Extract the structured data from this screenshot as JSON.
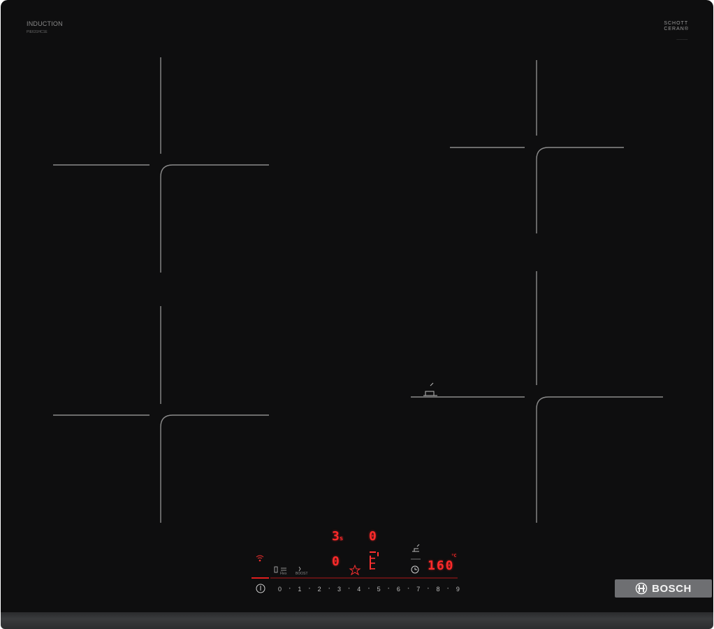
{
  "panel": {
    "brand_label": "INDUCTION",
    "model_label": "PIE631HC1E",
    "glass_brand_top": "SCHOTT",
    "glass_brand_bottom": "CERAN®",
    "manufacturer": "BOSCH"
  },
  "display": {
    "timer_top": "3",
    "timer_top_unit": "s",
    "zone_top_value": "0",
    "zone_bottom_value": "0",
    "temperature": "160",
    "temperature_unit": "°C"
  },
  "control_labels": {
    "flex": "Flex",
    "boost": "BOOST",
    "power_icon": "power-icon",
    "wifi_icon": "wifi-icon",
    "favorite_icon": "star-icon",
    "timer_icon": "clock-icon",
    "pan_sensor_icon": "frying-sensor-icon"
  },
  "power_scale": [
    "0",
    "1",
    "2",
    "3",
    "4",
    "5",
    "6",
    "7",
    "8",
    "9"
  ],
  "colors": {
    "glass": "#0e0e0f",
    "display_red": "#ff2a2a",
    "zone_lines": "#8c8c8c",
    "bosch_plate": "#6e6f72"
  }
}
